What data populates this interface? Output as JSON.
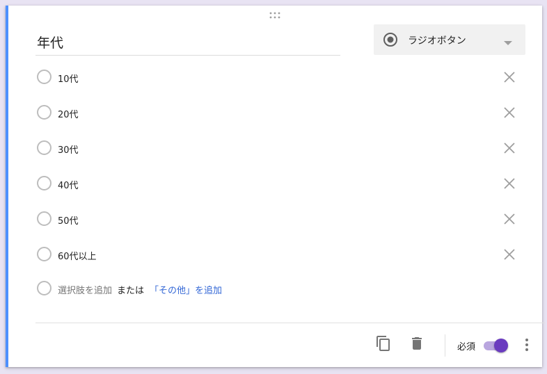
{
  "question": {
    "title": "年代",
    "type_label": "ラジオボタン"
  },
  "options": [
    {
      "label": "10代"
    },
    {
      "label": "20代"
    },
    {
      "label": "30代"
    },
    {
      "label": "40代"
    },
    {
      "label": "50代"
    },
    {
      "label": "60代以上"
    }
  ],
  "add_row": {
    "add_option": "選択肢を追加",
    "or_text": "または",
    "add_other": "「その他」を追加"
  },
  "footer": {
    "required_label": "必須",
    "required_on": true
  },
  "colors": {
    "accent": "#6a3bbf",
    "link": "#3367d6",
    "focus_border": "#4d90fe"
  }
}
